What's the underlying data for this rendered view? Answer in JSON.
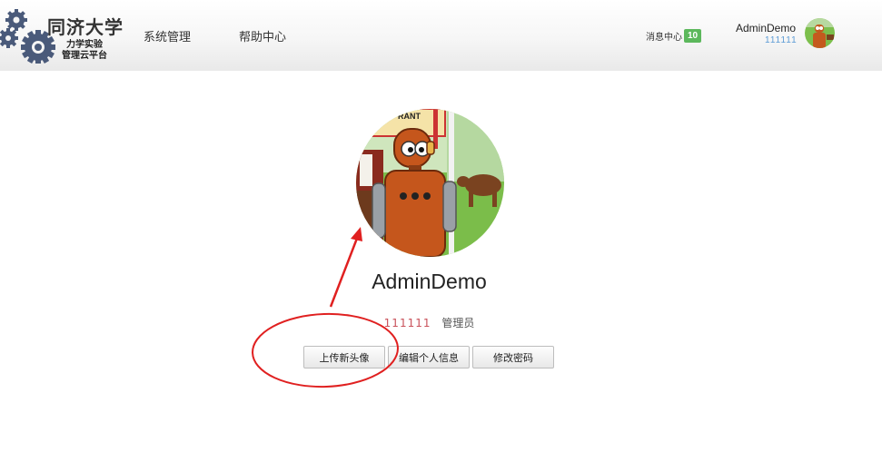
{
  "header": {
    "logo": {
      "title": "同济大学",
      "subtitle_line1": "力学实验",
      "subtitle_line2": "管理云平台"
    },
    "nav": [
      {
        "label": "系统管理"
      },
      {
        "label": "帮助中心"
      }
    ],
    "messages": {
      "label": "消息中心",
      "count": "10"
    },
    "user": {
      "name": "AdminDemo",
      "id": "111111"
    }
  },
  "profile": {
    "name": "AdminDemo",
    "id": "111111",
    "role": "管理员",
    "avatar_sign_text": "RANT",
    "buttons": {
      "upload": "上传新头像",
      "edit": "编辑个人信息",
      "password": "修改密码"
    }
  },
  "colors": {
    "badge": "#5cb85c",
    "id_blue": "#5b9bd5",
    "id_red": "#c9525b",
    "annotation": "#e02020"
  }
}
